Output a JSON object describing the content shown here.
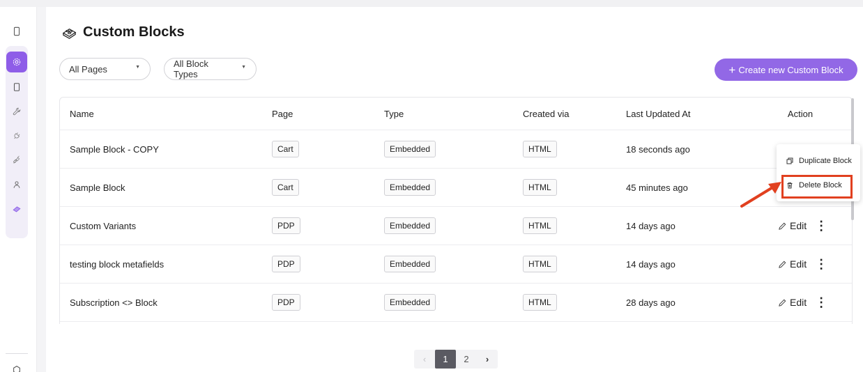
{
  "page": {
    "title": "Custom Blocks"
  },
  "filters": {
    "pages": "All Pages",
    "block_types": "All Block Types"
  },
  "create_button": {
    "plus": "+",
    "label": "Create new Custom Block"
  },
  "table": {
    "headers": {
      "name": "Name",
      "page": "Page",
      "type": "Type",
      "created_via": "Created via",
      "updated": "Last Updated At",
      "action": "Action"
    },
    "rows": [
      {
        "name": "Sample Block - COPY",
        "page": "Cart",
        "type": "Embedded",
        "created_via": "HTML",
        "updated": "18 seconds ago"
      },
      {
        "name": "Sample Block",
        "page": "Cart",
        "type": "Embedded",
        "created_via": "HTML",
        "updated": "45 minutes ago"
      },
      {
        "name": "Custom Variants",
        "page": "PDP",
        "type": "Embedded",
        "created_via": "HTML",
        "updated": "14 days ago"
      },
      {
        "name": "testing block metafields",
        "page": "PDP",
        "type": "Embedded",
        "created_via": "HTML",
        "updated": "14 days ago"
      },
      {
        "name": "Subscription <> Block",
        "page": "PDP",
        "type": "Embedded",
        "created_via": "HTML",
        "updated": "28 days ago"
      }
    ],
    "edit_label": "Edit",
    "more_glyph": "⋮"
  },
  "context_menu": {
    "duplicate": "Duplicate Block",
    "delete": "Delete Block"
  },
  "pagination": {
    "prev": "‹",
    "pages": [
      "1",
      "2"
    ],
    "current": "1",
    "next": "›"
  },
  "colors": {
    "accent": "#9268e6",
    "highlight": "#e1401f",
    "rail_active": "#8e5de8"
  },
  "icons": [
    "phone-icon",
    "settings-gear-icon",
    "tablet-icon",
    "wrench-icon",
    "plug-icon",
    "link-icon",
    "user-icon",
    "block-icon",
    "package-icon",
    "lego-block-icon",
    "pencil-icon",
    "copy-icon",
    "trash-icon"
  ]
}
